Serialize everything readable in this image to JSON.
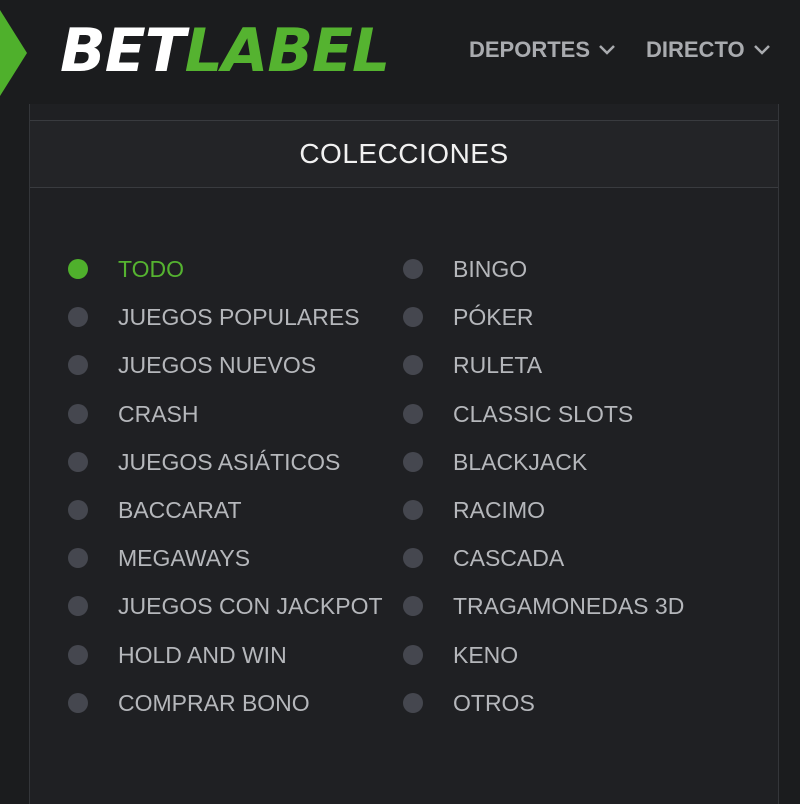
{
  "header": {
    "logo": {
      "part1": "BET",
      "part2": "LABEL"
    },
    "nav": [
      {
        "label": "DEPORTES"
      },
      {
        "label": "DIRECTO"
      }
    ]
  },
  "collections": {
    "title": "COLECCIONES",
    "left": [
      {
        "label": "TODO",
        "selected": true
      },
      {
        "label": "JUEGOS POPULARES",
        "selected": false
      },
      {
        "label": "JUEGOS NUEVOS",
        "selected": false
      },
      {
        "label": "CRASH",
        "selected": false
      },
      {
        "label": "JUEGOS ASIÁTICOS",
        "selected": false
      },
      {
        "label": "BACCARAT",
        "selected": false
      },
      {
        "label": "MEGAWAYS",
        "selected": false
      },
      {
        "label": "JUEGOS CON JACKPOT",
        "selected": false
      },
      {
        "label": "HOLD AND WIN",
        "selected": false
      },
      {
        "label": "COMPRAR BONO",
        "selected": false
      }
    ],
    "right": [
      {
        "label": "BINGO",
        "selected": false
      },
      {
        "label": "PÓKER",
        "selected": false
      },
      {
        "label": "RULETA",
        "selected": false
      },
      {
        "label": "CLASSIC SLOTS",
        "selected": false
      },
      {
        "label": "BLACKJACK",
        "selected": false
      },
      {
        "label": "RACIMO",
        "selected": false
      },
      {
        "label": "CASCADA",
        "selected": false
      },
      {
        "label": "TRAGAMONEDAS 3D",
        "selected": false
      },
      {
        "label": "KENO",
        "selected": false
      },
      {
        "label": "OTROS",
        "selected": false
      }
    ]
  },
  "colors": {
    "accent": "#55b330",
    "background": "#1b1c1e",
    "dot_inactive": "#45474f",
    "text_inactive": "#b5b7bb"
  }
}
